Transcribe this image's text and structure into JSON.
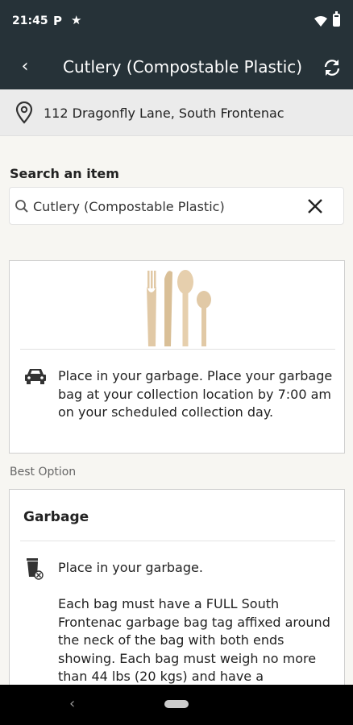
{
  "status_bar": {
    "time": "21:45",
    "notification_p": "P",
    "notification_star": "★"
  },
  "app_bar": {
    "back_icon": "‹",
    "title": "Cutlery (Compostable Plastic)"
  },
  "address": {
    "text": "112 Dragonfly Lane, South Frontenac"
  },
  "search": {
    "label": "Search an item",
    "value": "Cutlery (Compostable Plastic)"
  },
  "item_card": {
    "instruction": "Place in your garbage. Place your garbage bag at your collection location by 7:00 am on your scheduled collection day."
  },
  "best_option": {
    "label": "Best Option"
  },
  "option_card": {
    "title": "Garbage",
    "line": "Place in your garbage.",
    "rules": "Each bag must have a FULL South Frontenac garbage bag tag affixed around the neck of the bag with both ends showing. Each bag must weigh no more than 44 lbs (20 kgs) and have a"
  },
  "nav_bar": {
    "back_icon": "‹"
  },
  "colors": {
    "app_bar": "#263238",
    "background": "#f7f6f2",
    "address_bar": "#ebebeb",
    "wood": "#e1c9a6"
  }
}
